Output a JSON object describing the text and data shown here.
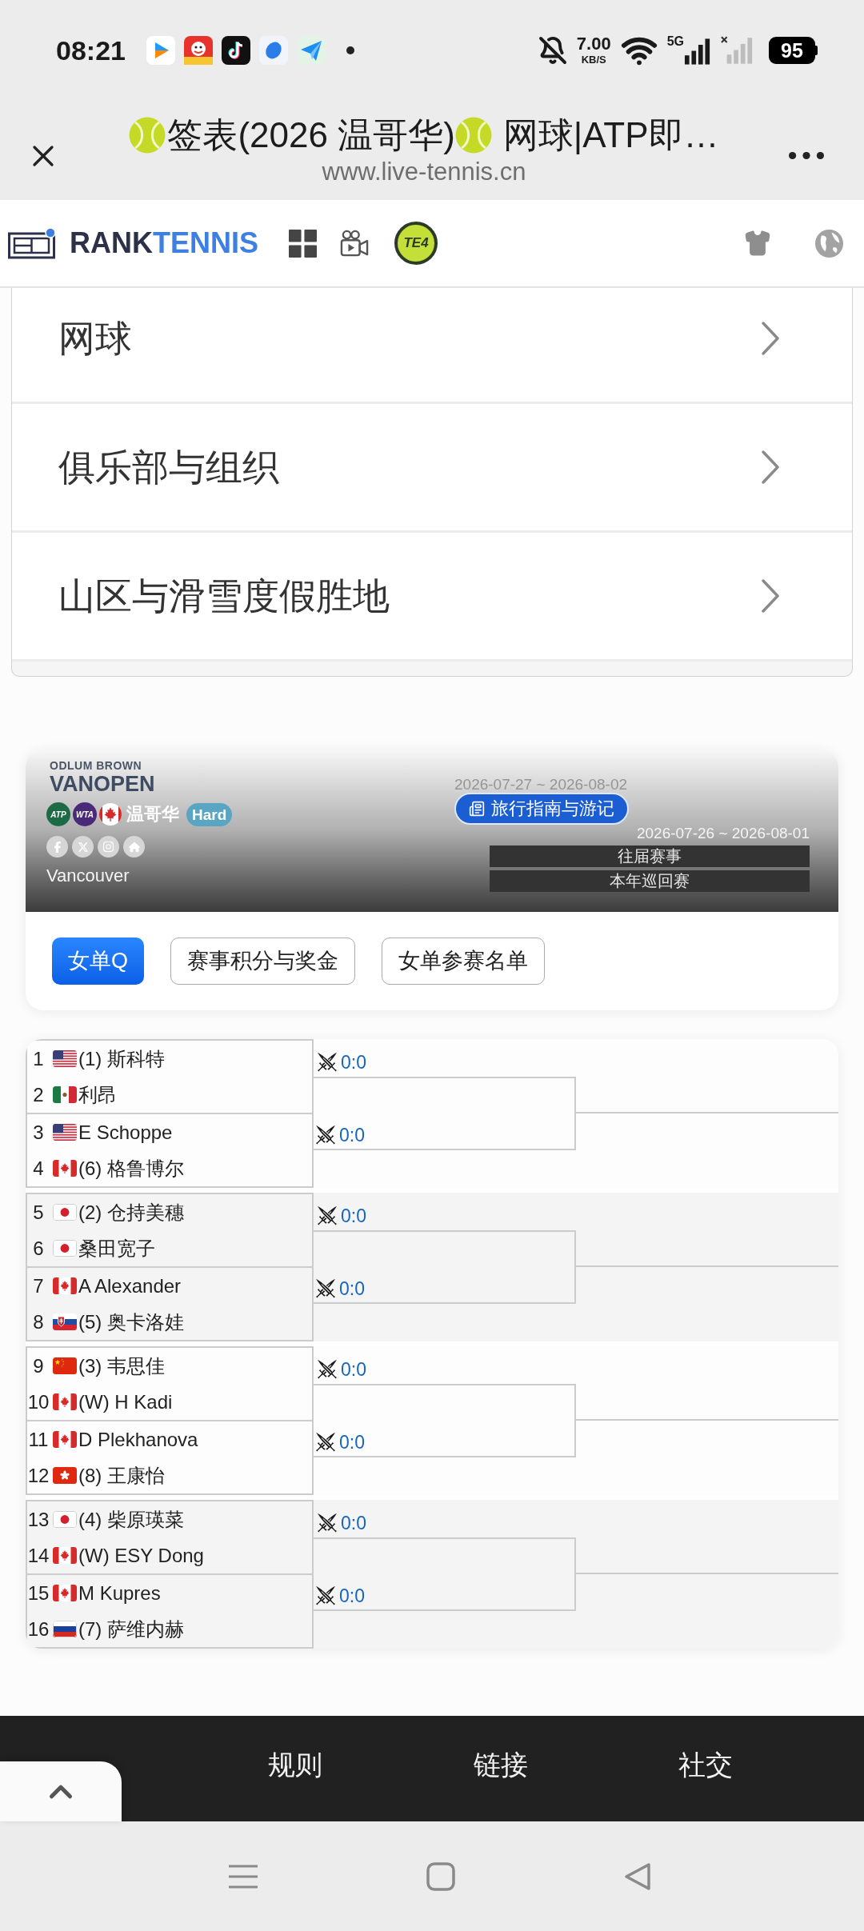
{
  "status_bar": {
    "time": "08:21",
    "speed": "7.00",
    "speed_unit": "KB/S",
    "network": "5G",
    "battery": "95"
  },
  "browser_bar": {
    "title_part1": "签表(2026 温哥华)",
    "title_part2": "网球|ATP即…",
    "url": "www.live-tennis.cn"
  },
  "site_header": {
    "brand_dark": "RANK",
    "brand_blue": "TENNIS",
    "circle_logo": "TE4"
  },
  "menu": {
    "items": [
      {
        "label": "网球"
      },
      {
        "label": "俱乐部与组织"
      },
      {
        "label": "山区与滑雪度假胜地"
      }
    ]
  },
  "tournament": {
    "logo_top": "ODLUM BROWN",
    "logo_main": "VANOPEN",
    "tours": [
      {
        "label": "ATP",
        "color": "#1d6b45"
      },
      {
        "label": "WTA",
        "color": "#4a2a78"
      }
    ],
    "country_flag": {
      "kind": "ca"
    },
    "city": "温哥华",
    "surface": "Hard",
    "location": "Vancouver",
    "faded_dates": "2026-07-27 ~ 2026-08-02",
    "guide_button": "旅行指南与游记",
    "dates": "2026-07-26 ~ 2026-08-01",
    "links": [
      "往届赛事",
      "本年巡回赛"
    ],
    "tabs": [
      {
        "label": "女单Q",
        "selected": true
      },
      {
        "label": "赛事积分与奖金",
        "selected": false
      },
      {
        "label": "女单参赛名单",
        "selected": false
      }
    ]
  },
  "draw": {
    "groups": [
      {
        "matches": [
          {
            "score": "0:0",
            "players": [
              {
                "number": "1",
                "flag": {
                  "kind": "us"
                },
                "name": "(1) 斯科特"
              },
              {
                "number": "2",
                "flag": {
                  "kind": "mx"
                },
                "name": "利昂"
              }
            ]
          },
          {
            "score": "0:0",
            "players": [
              {
                "number": "3",
                "flag": {
                  "kind": "us"
                },
                "name": "E Schoppe"
              },
              {
                "number": "4",
                "flag": {
                  "kind": "ca"
                },
                "name": "(6) 格鲁博尔"
              }
            ]
          }
        ]
      },
      {
        "matches": [
          {
            "score": "0:0",
            "players": [
              {
                "number": "5",
                "flag": {
                  "kind": "jp"
                },
                "name": "(2) 仓持美穗"
              },
              {
                "number": "6",
                "flag": {
                  "kind": "jp"
                },
                "name": "桑田宽子"
              }
            ]
          },
          {
            "score": "0:0",
            "players": [
              {
                "number": "7",
                "flag": {
                  "kind": "ca"
                },
                "name": "A Alexander"
              },
              {
                "number": "8",
                "flag": {
                  "kind": "sk"
                },
                "name": "(5) 奥卡洛娃"
              }
            ]
          }
        ]
      },
      {
        "matches": [
          {
            "score": "0:0",
            "players": [
              {
                "number": "9",
                "flag": {
                  "kind": "cn"
                },
                "name": "(3) 韦思佳"
              },
              {
                "number": "10",
                "flag": {
                  "kind": "ca"
                },
                "name": "(W) H Kadi"
              }
            ]
          },
          {
            "score": "0:0",
            "players": [
              {
                "number": "11",
                "flag": {
                  "kind": "ca"
                },
                "name": "D Plekhanova"
              },
              {
                "number": "12",
                "flag": {
                  "kind": "hk"
                },
                "name": "(8) 王康怡"
              }
            ]
          }
        ]
      },
      {
        "matches": [
          {
            "score": "0:0",
            "players": [
              {
                "number": "13",
                "flag": {
                  "kind": "jp"
                },
                "name": "(4) 柴原瑛菜"
              },
              {
                "number": "14",
                "flag": {
                  "kind": "ca"
                },
                "name": "(W) ESY Dong"
              }
            ]
          },
          {
            "score": "0:0",
            "players": [
              {
                "number": "15",
                "flag": {
                  "kind": "ca"
                },
                "name": "M Kupres"
              },
              {
                "number": "16",
                "flag": {
                  "kind": "ru"
                },
                "name": "(7) 萨维内赫"
              }
            ]
          }
        ]
      }
    ]
  },
  "footer": {
    "columns": [
      {
        "heading": "规则"
      },
      {
        "heading": "链接"
      },
      {
        "heading": "社交"
      }
    ]
  }
}
